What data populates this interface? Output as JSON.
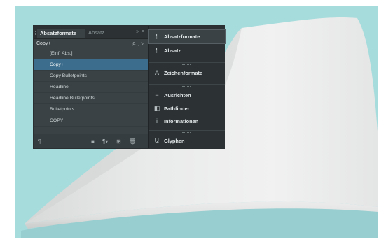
{
  "panel": {
    "tabs": [
      {
        "label": "Absatzformate",
        "active": true
      },
      {
        "label": "Absatz",
        "active": false
      }
    ],
    "menu_buttons": "»  ≡",
    "current_style": "Copy+",
    "current_style_icons": "[a+]  ϟ",
    "styles": [
      {
        "label": "[Einf. Abs.]",
        "selected": false
      },
      {
        "label": "Copy+",
        "selected": true
      },
      {
        "label": "Copy Bulletpoints",
        "selected": false
      },
      {
        "label": "Headline",
        "selected": false
      },
      {
        "label": "Headline Bulletpoints",
        "selected": false
      },
      {
        "label": "Bulletpoints",
        "selected": false
      },
      {
        "label": "COPY",
        "selected": false
      }
    ],
    "bottom_icons": [
      "¶",
      "■",
      "¶▾",
      "⊞",
      "🗑"
    ]
  },
  "dock": {
    "items": [
      {
        "label": "Absatzformate",
        "icon": "paragraph-styles-icon",
        "glyph": "¶",
        "active": true
      },
      {
        "label": "Absatz",
        "icon": "paragraph-icon",
        "glyph": "¶",
        "active": false
      },
      {
        "label": "Zeichenformate",
        "icon": "character-styles-icon",
        "glyph": "A",
        "active": false
      },
      {
        "label": "Ausrichten",
        "icon": "align-icon",
        "glyph": "≡",
        "active": false
      },
      {
        "label": "Pathfinder",
        "icon": "pathfinder-icon",
        "glyph": "◧",
        "active": false
      },
      {
        "label": "Informationen",
        "icon": "info-icon",
        "glyph": "i",
        "active": false
      },
      {
        "label": "Glyphen",
        "icon": "glyphs-icon",
        "glyph": "Ա",
        "active": false
      }
    ]
  },
  "colors": {
    "backdrop": "#a7dcdd",
    "panel": "#3a4245",
    "dock": "#2c3234",
    "selection": "#3d6d8c"
  }
}
